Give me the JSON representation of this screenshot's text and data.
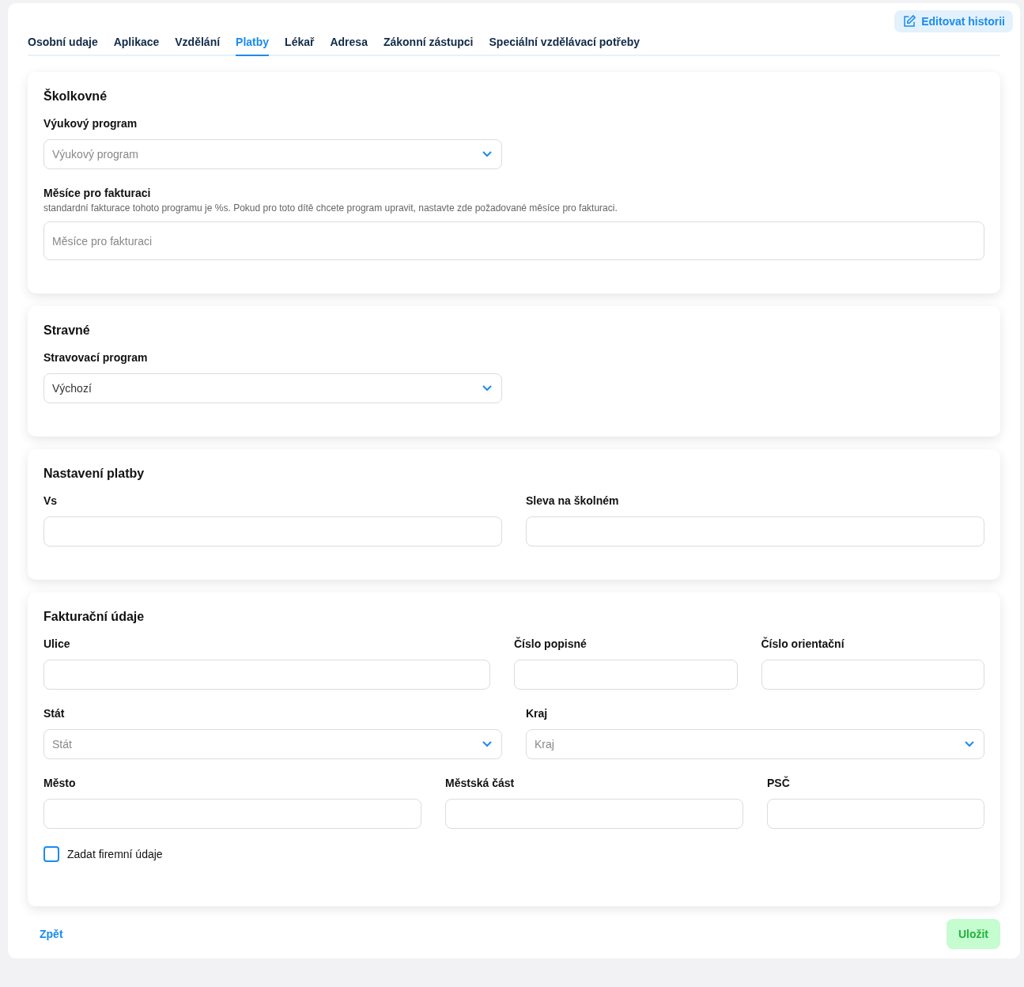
{
  "edit_button": {
    "label": "Editovat historii"
  },
  "tabs": [
    {
      "label": "Osobní udaje",
      "selected": false
    },
    {
      "label": "Aplikace",
      "selected": false
    },
    {
      "label": "Vzdělání",
      "selected": false
    },
    {
      "label": "Platby",
      "selected": true
    },
    {
      "label": "Lékař",
      "selected": false
    },
    {
      "label": "Adresa",
      "selected": false
    },
    {
      "label": "Zákonní zástupci",
      "selected": false
    },
    {
      "label": "Speciální vzdělávací potřeby",
      "selected": false
    }
  ],
  "sections": [
    {
      "title": "Školkovné",
      "rows": [
        [
          {
            "kind": "select",
            "label": "Výukový program",
            "placeholder": "Výukový program"
          }
        ],
        [
          {
            "kind": "text",
            "label": "Měsíce pro fakturaci",
            "hint": "standardní fakturace tohoto programu je %s. Pokud pro toto dítě chcete program upravit, nastavte zde požadované měsíce pro fakturaci.",
            "placeholder": "Měsíce pro fakturaci"
          }
        ]
      ]
    },
    {
      "title": "Stravné",
      "rows": [
        [
          {
            "kind": "select",
            "label": "Stravovací program",
            "value": "Výchozí"
          }
        ]
      ]
    },
    {
      "title": "Nastavení platby",
      "rows": [
        [
          {
            "kind": "text",
            "label": "Vs"
          },
          {
            "kind": "text",
            "label": "Sleva na školném"
          }
        ]
      ]
    },
    {
      "title": "Fakturační údaje",
      "rows": [
        [
          {
            "kind": "text",
            "label": "Ulice"
          },
          {
            "kind": "text",
            "label": "Číslo popisné"
          },
          {
            "kind": "text",
            "label": "Číslo orientační"
          }
        ],
        [
          {
            "kind": "select",
            "label": "Stát",
            "placeholder": "Stát"
          },
          {
            "kind": "select",
            "label": "Kraj",
            "placeholder": "Kraj"
          }
        ],
        [
          {
            "kind": "text",
            "label": "Město"
          },
          {
            "kind": "text",
            "label": "Městská část"
          },
          {
            "kind": "text",
            "label": "PSČ"
          }
        ]
      ],
      "checkbox": {
        "label": "Zadat firemní údaje",
        "checked": false
      }
    }
  ],
  "back_link": "Zpět",
  "save_button": "Uložit"
}
